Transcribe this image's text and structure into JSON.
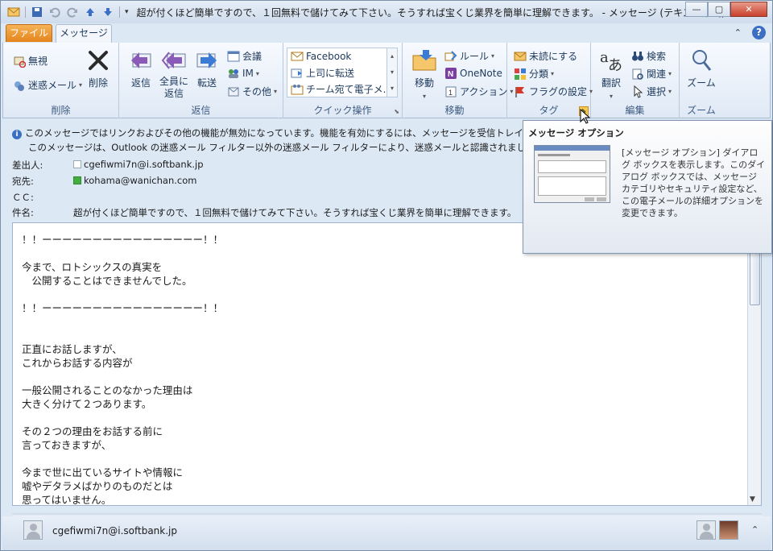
{
  "window": {
    "title": "超が付くほど簡単ですので、１回無料で儲けてみて下さい。そうすれば宝くじ業界を簡単に理解できます。 - メッセージ (テキスト形式)"
  },
  "tabs": {
    "file": "ファイル",
    "message": "メッセージ"
  },
  "ribbon": {
    "delete_group": {
      "ignore": "無視",
      "junk": "迷惑メール",
      "delete": "削除",
      "label": "削除"
    },
    "respond_group": {
      "reply": "返信",
      "reply_all_1": "全員に",
      "reply_all_2": "返信",
      "forward": "転送",
      "meeting": "会議",
      "im": "IM",
      "more": "その他",
      "label": "返信"
    },
    "quick_steps": {
      "items": [
        "Facebook",
        "上司に転送",
        "チーム宛て電子メ..."
      ],
      "label": "クイック操作"
    },
    "move_group": {
      "move": "移動",
      "rules": "ルール",
      "onenote": "OneNote",
      "actions": "アクション",
      "label": "移動"
    },
    "tags_group": {
      "unread": "未読にする",
      "categorize": "分類",
      "follow_up": "フラグの設定",
      "label": "タグ"
    },
    "edit_group": {
      "translate": "翻訳",
      "find": "検索",
      "related": "関連",
      "select": "選択",
      "label": "編集"
    },
    "zoom_group": {
      "zoom": "ズーム",
      "label": "ズーム"
    }
  },
  "info_bar": {
    "line1": "このメッセージではリンクおよびその他の機能が無効になっています。機能を有効にするには、メッセージを受信トレイに移動してください。",
    "line2": "このメッセージは、Outlook の迷惑メール フィルター以外の迷惑メール フィルターにより、迷惑メールと認識されました。"
  },
  "headers": {
    "from_label": "差出人:",
    "from_value": "cgefiwmi7n@i.softbank.jp",
    "to_label": "宛先:",
    "to_value": "kohama@wanichan.com",
    "cc_label": "ＣＣ:",
    "subject_label": "件名:",
    "subject_value": "超が付くほど簡単ですので、１回無料で儲けてみて下さい。そうすれば宝くじ業界を簡単に理解できます。"
  },
  "message_body": [
    "！！ーーーーーーーーーーーーーーーー！！",
    "",
    "今まで、ロトシックスの真実を",
    "　公開することはできませんでした。",
    "",
    "！！ーーーーーーーーーーーーーーーー！！",
    "",
    "",
    "正直にお話しますが、",
    "これからお話する内容が",
    "",
    "一般公開されることのなかった理由は",
    "大きく分けて２つあります。",
    "",
    "その２つの理由をお話する前に",
    "言っておきますが、",
    "",
    "今まで世に出ているサイトや情報に",
    "嘘やデタラメばかりのものだとは",
    "思ってはいません。"
  ],
  "footer": {
    "sender": "cgefiwmi7n@i.softbank.jp"
  },
  "tooltip": {
    "title": "メッセージ オプション",
    "text": "[メッセージ オプション] ダイアログ ボックスを表示します。このダイアログ ボックスでは、メッセージ カテゴリやセキュリティ設定など、この電子メールの詳細オプションを変更できます。"
  }
}
